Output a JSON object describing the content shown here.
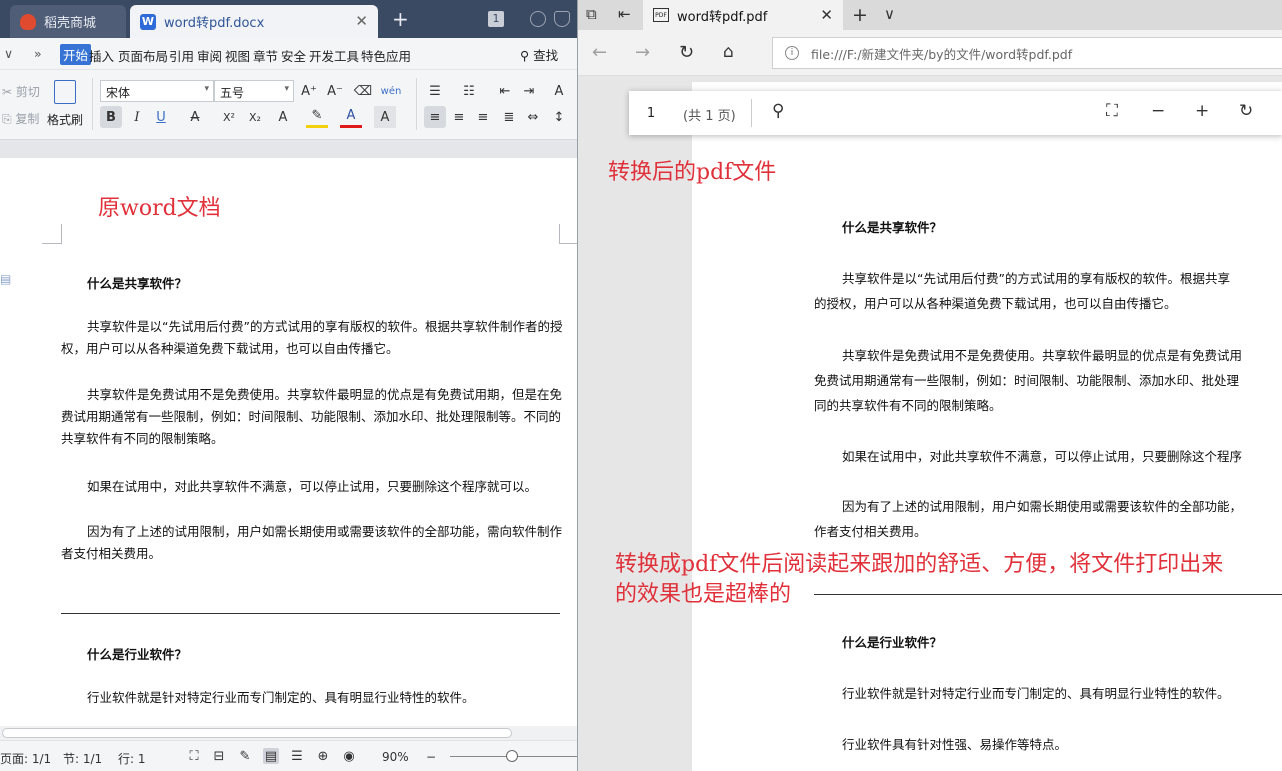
{
  "wps": {
    "tabs": [
      {
        "label": "稻壳商城"
      },
      {
        "label": "word转pdf.docx"
      }
    ],
    "tab_badge": "1",
    "menu": {
      "items": [
        "开始",
        "插入",
        "页面布局",
        "引用",
        "审阅",
        "视图",
        "章节",
        "安全",
        "开发工具",
        "特色应用"
      ],
      "search": "查找"
    },
    "ribbon": {
      "cut": "剪切",
      "copy": "复制",
      "format_painter": "格式刷",
      "font_name": "宋体",
      "font_size": "五号",
      "bold": "B",
      "italic": "I",
      "underline": "U",
      "strike": "A",
      "superscript": "X²",
      "subscript": "X₂",
      "font_color": "A",
      "char_shade": "A",
      "pinyin": "wén"
    },
    "annotation": "原word文档",
    "doc": {
      "h1": "什么是共享软件？",
      "p1": "共享软件是以“先试用后付费”的方式试用的享有版权的软件。根据共享软件制作者的授权，用户可以从各种渠道免费下载试用，也可以自由传播它。",
      "p2": "共享软件是免费试用不是免费使用。共享软件最明显的优点是有免费试用期，但是在免费试用期通常有一些限制，例如：时间限制、功能限制、添加水印、批处理限制等。不同的共享软件有不同的限制策略。",
      "p3": "如果在试用中，对此共享软件不满意，可以停止试用，只要删除这个程序就可以。",
      "p4": "因为有了上述的试用限制，用户如需长期使用或需要该软件的全部功能，需向软件制作者支付相关费用。",
      "h2": "什么是行业软件？",
      "p5": "行业软件就是针对特定行业而专门制定的、具有明显行业特性的软件。"
    },
    "status": {
      "page": "页面: 1/1",
      "section": "节: 1/1",
      "line": "行: 1",
      "zoom": "90%"
    }
  },
  "edge": {
    "tab_title": "word转pdf.pdf",
    "pdf_icon_text": "PDF",
    "address": "file:///F:/新建文件夹/by的文件/word转pdf.pdf",
    "toolbar": {
      "page": "1",
      "total": "(共 1 页)"
    },
    "annotation_top": "转换后的pdf文件",
    "annotation_mid_1": "转换成pdf文件后阅读起来跟加的舒适、方便，将文件打印出来",
    "annotation_mid_2": "的效果也是超棒的",
    "pdf": {
      "h1": "什么是共享软件？",
      "l1": "共享软件是以“先试用后付费”的方式试用的享有版权的软件。根据共享",
      "l2": "的授权，用户可以从各种渠道免费下载试用，也可以自由传播它。",
      "l3": "共享软件是免费试用不是免费使用。共享软件最明显的优点是有免费试用",
      "l4": "免费试用期通常有一些限制，例如：时间限制、功能限制、添加水印、批处理",
      "l5": "同的共享软件有不同的限制策略。",
      "l6": "如果在试用中，对此共享软件不满意，可以停止试用，只要删除这个程序",
      "l7": "因为有了上述的试用限制，用户如需长期使用或需要该软件的全部功能，",
      "l8": "作者支付相关费用。",
      "h2": "什么是行业软件？",
      "l9": "行业软件就是针对特定行业而专门制定的、具有明显行业特性的软件。",
      "l10": "行业软件具有针对性强、易操作等特点。"
    }
  },
  "colors": {
    "annotation": "#e0313a",
    "wps_tabbar": "#3b4a63",
    "wps_active_menu": "#3673d4"
  }
}
